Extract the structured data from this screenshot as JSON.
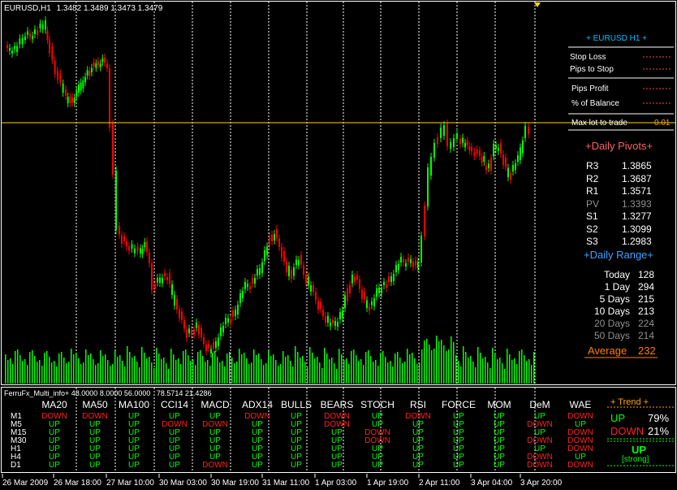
{
  "header": {
    "symbol": "EURUSD,H1",
    "ohlc": "1.3482 1.3489 1.3473 1.3479"
  },
  "info_panel": {
    "title": "+ EURUSD H1 +",
    "stop_loss_label": "Stop Loss",
    "pips_to_stop_label": "Pips to Stop",
    "pips_profit_label": "Pips Profit",
    "pct_balance_label": "% of Balance",
    "max_lot_label": "Max lot to trade",
    "max_lot_value": "0.01",
    "pivots_title": "+Daily Pivots+",
    "pivots": [
      {
        "name": "R3",
        "value": "1.3865"
      },
      {
        "name": "R2",
        "value": "1.3687"
      },
      {
        "name": "R1",
        "value": "1.3571"
      },
      {
        "name": "PV",
        "value": "1.3393"
      },
      {
        "name": "S1",
        "value": "1.3277"
      },
      {
        "name": "S2",
        "value": "1.3099"
      },
      {
        "name": "S3",
        "value": "1.2983"
      }
    ],
    "range_title": "+Daily Range+",
    "ranges": [
      {
        "name": "Today",
        "value": "128"
      },
      {
        "name": "1 Day",
        "value": "294"
      },
      {
        "name": "5 Days",
        "value": "215"
      },
      {
        "name": "10 Days",
        "value": "213"
      },
      {
        "name": "20 Days",
        "value": "224"
      },
      {
        "name": "50 Days",
        "value": "214"
      }
    ],
    "average_label": "Average",
    "average_value": "232"
  },
  "indicator": {
    "header": "FerruFx_Multi_info+ 48.0000 8.0000 56.0000",
    "header2": "78.5714 21.4286",
    "columns": [
      "MA20",
      "MA50",
      "MA100",
      "CCI14",
      "MACD",
      "ADX14",
      "BULLS",
      "BEARS",
      "STOCH",
      "RSI",
      "FORCE",
      "MOM",
      "DeM",
      "WAE"
    ],
    "timeframes": [
      "M1",
      "M5",
      "M15",
      "M30",
      "H1",
      "H4",
      "D1"
    ],
    "grid": [
      [
        "DOWN",
        "DOWN",
        "UP",
        "UP",
        "UP",
        "DOWN",
        "UP",
        "DOWN",
        "UP",
        "DOWN",
        "UP",
        "UP",
        "UP",
        "DOWN"
      ],
      [
        "UP",
        "UP",
        "UP",
        "DOWN",
        "DOWN",
        "UP",
        "UP",
        "DOWN",
        "UP",
        "UP",
        "UP",
        "UP",
        "DOWN",
        "UP"
      ],
      [
        "UP",
        "UP",
        "UP",
        "UP",
        "UP",
        "UP",
        "UP",
        "UP",
        "DOWN",
        "UP",
        "UP",
        "UP",
        "UP",
        "DOWN"
      ],
      [
        "UP",
        "UP",
        "UP",
        "UP",
        "UP",
        "UP",
        "UP",
        "UP",
        "DOWN",
        "UP",
        "UP",
        "UP",
        "DOWN",
        "DOWN"
      ],
      [
        "UP",
        "UP",
        "UP",
        "UP",
        "UP",
        "UP",
        "UP",
        "UP",
        "UP",
        "UP",
        "UP",
        "UP",
        "UP",
        "DOWN"
      ],
      [
        "UP",
        "UP",
        "UP",
        "UP",
        "UP",
        "UP",
        "UP",
        "UP",
        "UP",
        "UP",
        "UP",
        "UP",
        "DOWN",
        "UP"
      ],
      [
        "UP",
        "UP",
        "UP",
        "UP",
        "DOWN",
        "UP",
        "UP",
        "UP",
        "UP",
        "UP",
        "UP",
        "UP",
        "DOWN",
        "DOWN"
      ]
    ],
    "trend_title": "+ Trend +",
    "up_label": "UP",
    "up_pct": "79%",
    "down_label": "DOWN",
    "down_pct": "21%",
    "trend_result": "UP",
    "trend_strength": "[strong]"
  },
  "x_axis": {
    "labels": [
      "26 Mar 2009",
      "26 Mar 18:00",
      "27 Mar 10:00",
      "30 Mar 03:00",
      "30 Mar 19:00",
      "31 Mar 11:00",
      "1 Apr 03:00",
      "1 Apr 19:00",
      "2 Apr 11:00",
      "3 Apr 04:00",
      "3 Apr 20:00"
    ]
  },
  "colors": {
    "bull": "#00ff00",
    "bear": "#ff0000",
    "price_line": "#ffd700",
    "grid": "#ffffff",
    "panel_label": "#ffffff",
    "pivot_title": "#ff6060",
    "range_title": "#40a0ff",
    "average": "#ff7f00"
  },
  "chart_data": {
    "type": "candlestick",
    "current_price": 1.3479
  }
}
